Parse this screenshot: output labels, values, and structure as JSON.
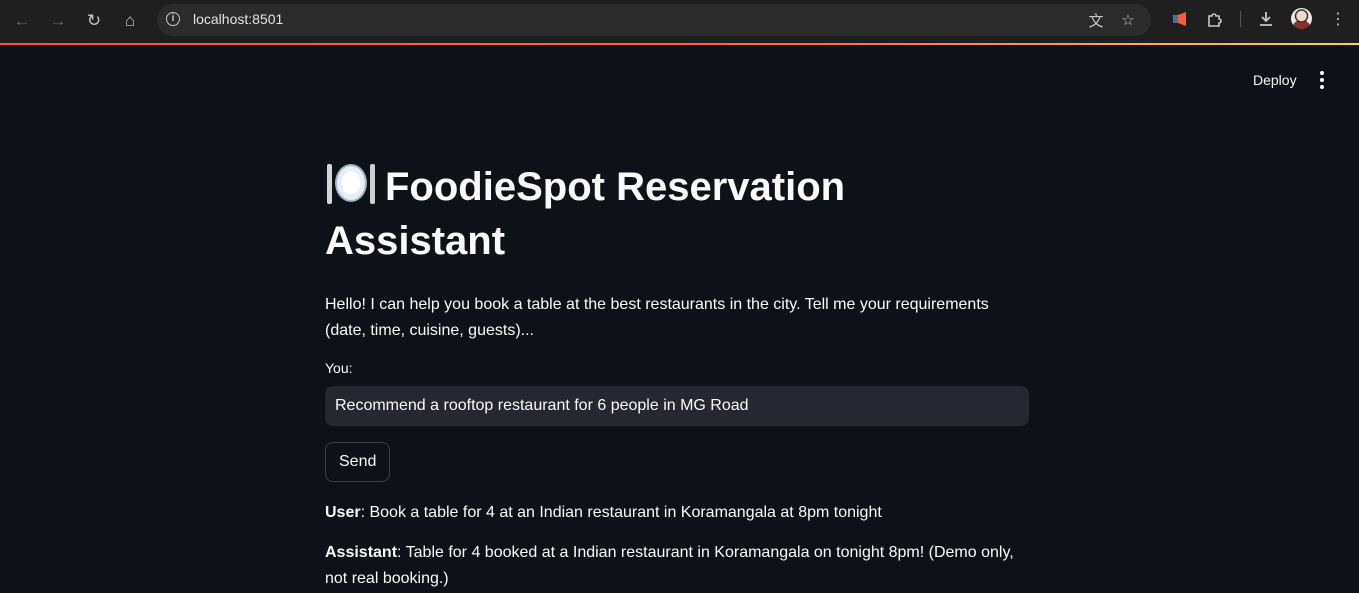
{
  "browser": {
    "url": "localhost:8501"
  },
  "header": {
    "deploy_label": "Deploy"
  },
  "main": {
    "title": "FoodieSpot Reservation Assistant",
    "intro": "Hello! I can help you book a table at the best restaurants in the city. Tell me your requirements (date, time, cuisine, guests)...",
    "input_label": "You:",
    "input_value": "Recommend a rooftop restaurant for 6 people in MG Road",
    "send_label": "Send",
    "messages": [
      {
        "role": "User",
        "text": "Book a table for 4 at an Indian restaurant in Koramangala at 8pm tonight"
      },
      {
        "role": "Assistant",
        "text": "Table for 4 booked at a Indian restaurant in Koramangala on tonight 8pm! (Demo only, not real booking.)"
      }
    ]
  },
  "icons": [
    "back-icon",
    "forward-icon",
    "reload-icon",
    "home-icon",
    "site-info-icon",
    "translate-icon",
    "bookmark-star-icon",
    "extension-puzzle-icon",
    "download-icon",
    "profile-avatar",
    "browser-menu-icon",
    "plate-with-cutlery-icon",
    "kebab-menu-icon"
  ],
  "colors": {
    "background": "#0e1117",
    "input_background": "#262730",
    "text": "#fafafa",
    "accent_stripe_start": "#ff4b4b",
    "accent_stripe_end": "#ffd34f"
  }
}
